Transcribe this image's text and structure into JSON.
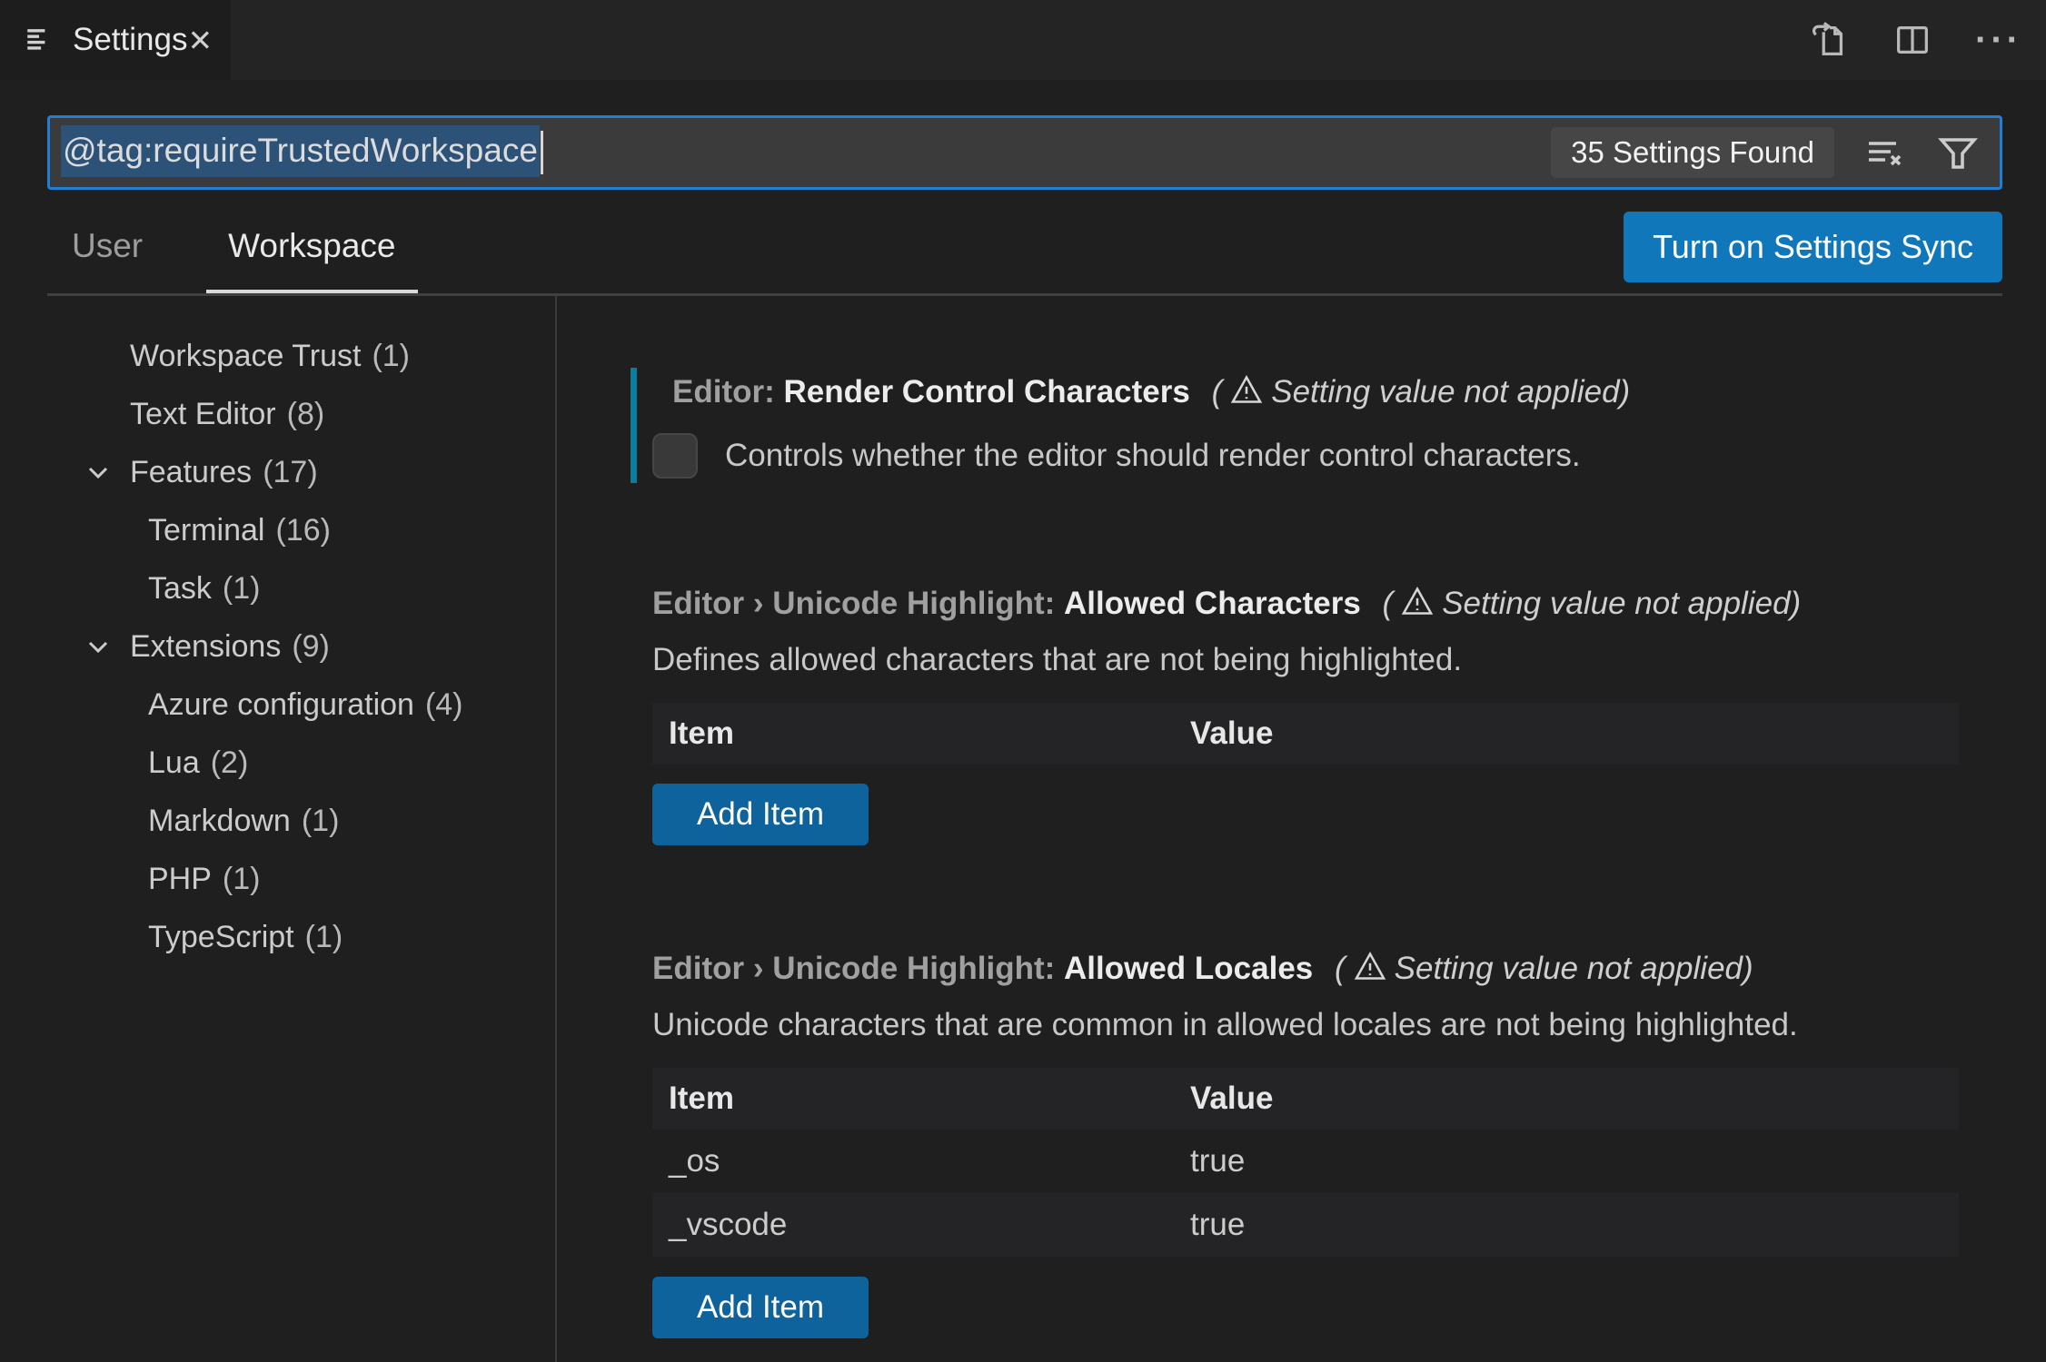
{
  "tab": {
    "title": "Settings"
  },
  "icons": {
    "close": "✕",
    "more_actions": "···"
  },
  "search": {
    "query": "@tag:requireTrustedWorkspace",
    "results_badge": "35 Settings Found"
  },
  "scope_tabs": {
    "user": "User",
    "workspace": "Workspace"
  },
  "sync": {
    "label": "Turn on Settings Sync"
  },
  "sidebar": {
    "items": [
      {
        "label": "Workspace Trust",
        "count": "(1)"
      },
      {
        "label": "Text Editor",
        "count": "(8)"
      },
      {
        "label": "Features",
        "count": "(17)"
      },
      {
        "label": "Terminal",
        "count": "(16)"
      },
      {
        "label": "Task",
        "count": "(1)"
      },
      {
        "label": "Extensions",
        "count": "(9)"
      },
      {
        "label": "Azure configuration",
        "count": "(4)"
      },
      {
        "label": "Lua",
        "count": "(2)"
      },
      {
        "label": "Markdown",
        "count": "(1)"
      },
      {
        "label": "PHP",
        "count": "(1)"
      },
      {
        "label": "TypeScript",
        "count": "(1)"
      }
    ]
  },
  "ui": {
    "add_item": "Add Item"
  },
  "settings": [
    {
      "category": "Editor:",
      "name": "Render Control Characters",
      "warn_open": "(",
      "warn_label": "Setting value not applied)",
      "description": "Controls whether the editor should render control characters."
    },
    {
      "category": "Editor › Unicode Highlight:",
      "name": "Allowed Characters",
      "warn_open": "(",
      "warn_label": "Setting value not applied)",
      "description": "Defines allowed characters that are not being highlighted.",
      "table": {
        "headers": [
          "Item",
          "Value"
        ],
        "rows": []
      }
    },
    {
      "category": "Editor › Unicode Highlight:",
      "name": "Allowed Locales",
      "warn_open": "(",
      "warn_label": "Setting value not applied)",
      "description": "Unicode characters that are common in allowed locales are not being highlighted.",
      "table": {
        "headers": [
          "Item",
          "Value"
        ],
        "rows": [
          {
            "item": "_os",
            "value": "true"
          },
          {
            "item": "_vscode",
            "value": "true"
          }
        ]
      }
    }
  ],
  "colors": {
    "focus_border": "#1f7fd4",
    "selection": "#2d5278",
    "modified_indicator": "#0c7d9d",
    "button": "#0e639c",
    "button_bright": "#1177bb"
  }
}
